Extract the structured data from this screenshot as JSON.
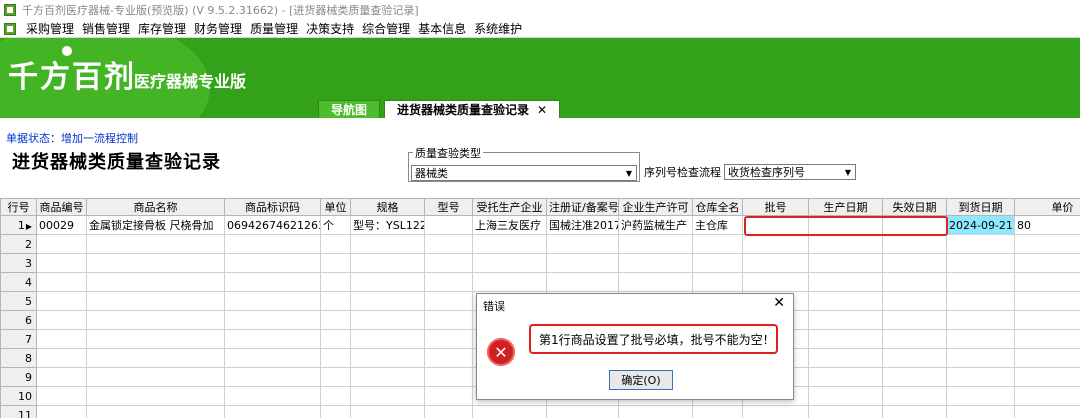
{
  "window": {
    "title": "千方百剂医疗器械-专业版(预览版) (V 9.5.2.31662)   - [进货器械类质量查验记录]"
  },
  "menu": [
    "采购管理",
    "销售管理",
    "库存管理",
    "财务管理",
    "质量管理",
    "决策支持",
    "综合管理",
    "基本信息",
    "系统维护"
  ],
  "banner": {
    "logo": "千方百剂",
    "subtitle": "医疗器械专业版"
  },
  "tabs": {
    "nav": "导航图",
    "active": "进货器械类质量查验记录",
    "close": "✕"
  },
  "doc": {
    "status": "单据状态：增加一流程控制",
    "title": "进货器械类质量查验记录",
    "qc_group_label": "质量查验类型",
    "qc_type": "器械类",
    "seq_label": "序列号检查流程",
    "seq_value": "收货检查序列号"
  },
  "grid": {
    "headers": [
      "行号",
      "商品编号",
      "商品名称",
      "商品标识码",
      "单位",
      "规格",
      "型号",
      "受托生产企业",
      "注册证/备案号",
      "企业生产许可",
      "仓库全名",
      "批号",
      "生产日期",
      "失效日期",
      "到货日期",
      "单价"
    ],
    "row1": {
      "num": "1",
      "code": "00029",
      "name": "金属锁定接骨板 尺桡骨加",
      "udi": "06942674621263",
      "unit": "个",
      "spec": "型号：YSL122",
      "model": "",
      "maker": "上海三友医疗",
      "reg": "国械注准2017",
      "license": "沪药监械生产",
      "warehouse": "主仓库",
      "batch": "",
      "mfg_date": "",
      "exp_date": "",
      "arrival": "2024-09-21",
      "price": "80"
    },
    "empty_rows": [
      "2",
      "3",
      "4",
      "5",
      "6",
      "7",
      "8",
      "9",
      "10",
      "11"
    ]
  },
  "dialog": {
    "title": "错误",
    "close": "✕",
    "icon": "error-icon",
    "message": "第1行商品设置了批号必填，批号不能为空！",
    "ok_label": "确定(O)"
  },
  "colors": {
    "banner_green": "#33a119",
    "highlight_cyan": "#8ee8ff",
    "error_red": "#e02020"
  }
}
